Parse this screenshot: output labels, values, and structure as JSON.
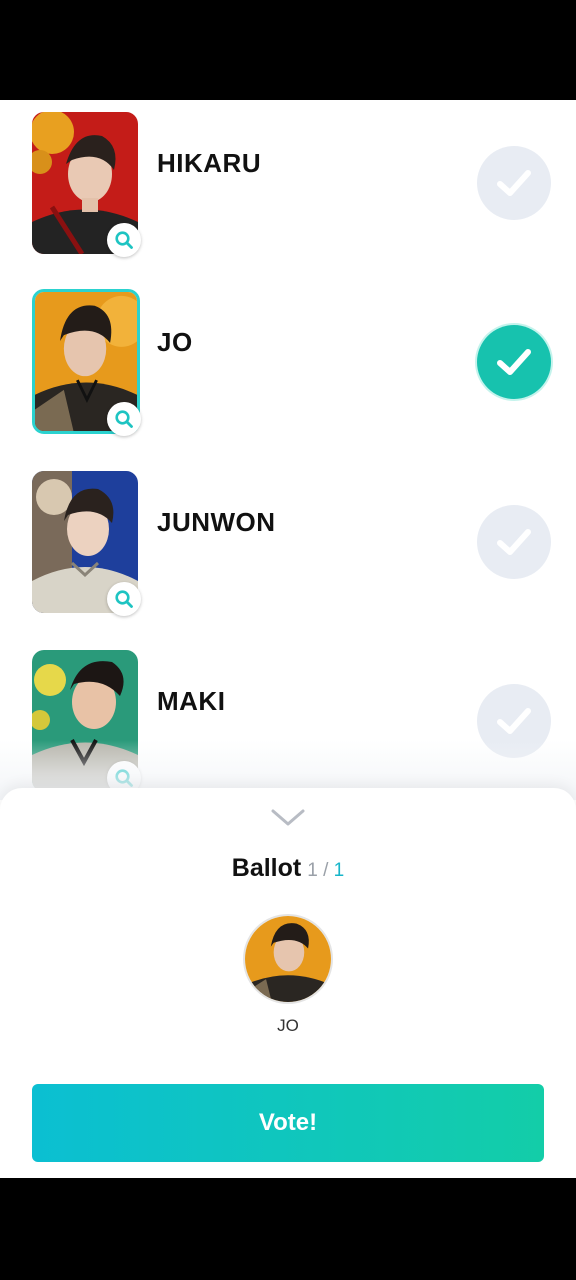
{
  "candidates": [
    {
      "name": "HIKARU",
      "selected": false,
      "photo_bg": "#c41c18",
      "photo_accent": "#e8a020"
    },
    {
      "name": "JO",
      "selected": true,
      "photo_bg": "#e79a1c",
      "photo_accent": "#3a2a1a"
    },
    {
      "name": "JUNWON",
      "selected": false,
      "photo_bg": "#1e3f9c",
      "photo_accent": "#d8d4c8"
    },
    {
      "name": "MAKI",
      "selected": false,
      "photo_bg": "#2a9a7a",
      "photo_accent": "#e6d84a"
    }
  ],
  "ballot": {
    "title": "Ballot",
    "count_current": "1",
    "count_separator": "/",
    "count_total": "1",
    "selected_name": "JO"
  },
  "vote_button": {
    "label": "Vote!"
  },
  "colors": {
    "accent": "#17c2ae",
    "check_off": "#e8ecf3",
    "button_start": "#0bbfd2",
    "button_end": "#13cda8"
  },
  "icons": {
    "zoom": "magnifier-icon",
    "check": "checkmark-icon",
    "collapse": "chevron-down-icon"
  }
}
